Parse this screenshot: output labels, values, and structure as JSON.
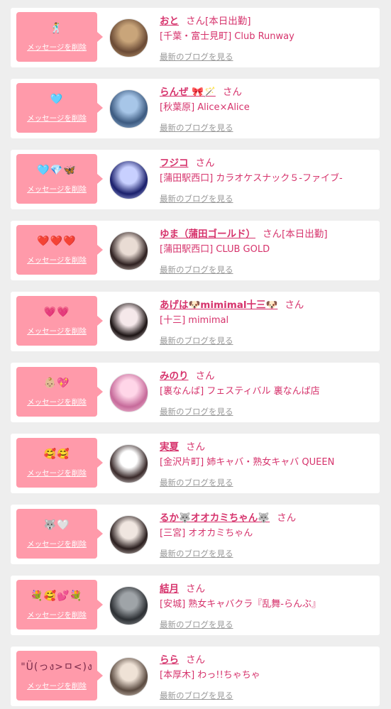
{
  "colors": {
    "accent": "#d6336c",
    "delete_bg": "#ff9aaa",
    "page_bg": "#eeeeee"
  },
  "labels": {
    "delete": "メッセージを削除",
    "blog": "最新のブログを見る",
    "san": "さん"
  },
  "entries": [
    {
      "icons": "🕺",
      "name": "おと",
      "status": "[本日出勤]",
      "shop": "[千葉・富士見町] Club Runway",
      "avatar": [
        "#c9a57a",
        "#6a4a35"
      ]
    },
    {
      "icons": "🩵",
      "name": "らんぜ 🎀🪄",
      "status": "",
      "shop": "[秋葉原] Alice×Alice",
      "avatar": [
        "#a7c6e8",
        "#3c5a80"
      ]
    },
    {
      "icons": "🩵💎🦋",
      "name": "フジコ",
      "status": "",
      "shop": "[蒲田駅西口] カラオケスナック５-ファイブ-",
      "avatar": [
        "#c8d0ff",
        "#1a1f6b"
      ]
    },
    {
      "icons": "❤️❤️❤️",
      "name": "ゆま（蒲田ゴールド）",
      "status": "[本日出勤]",
      "shop": "[蒲田駅西口] CLUB GOLD",
      "avatar": [
        "#e9dcd4",
        "#2e2020"
      ]
    },
    {
      "icons": "💗💗",
      "name": "あげは🐶mimimal十三🐶",
      "status": "",
      "shop": "[十三] mimimal",
      "avatar": [
        "#f5e8ea",
        "#1c1414"
      ]
    },
    {
      "icons": "👶🏼💖",
      "name": "みのり",
      "status": "",
      "shop": "[裏なんば] フェスティバル 裏なんば店",
      "avatar": [
        "#ffd6e8",
        "#c66a9a"
      ]
    },
    {
      "icons": "🥰🥰",
      "name": "実夏",
      "status": "",
      "shop": "[金沢片町] 姉キャバ・熟女キャバ QUEEN",
      "avatar": [
        "#ffffff",
        "#3a2a2a"
      ]
    },
    {
      "icons": "🐺🤍",
      "name": "るか🐺オオカミちゃん🐺",
      "status": "",
      "shop": "[三宮] オオカミちゃん",
      "avatar": [
        "#f0e6e0",
        "#2a1e1e"
      ]
    },
    {
      "icons": "💐🥰💕💐",
      "name": "結月",
      "status": "",
      "shop": "[安城] 熟女キャバクラ『乱舞-らんぶ』",
      "avatar": [
        "#9fa4a8",
        "#2c2f33"
      ]
    },
    {
      "icons": "\"Ü(っง>ㅁ<)ง",
      "name": "らら",
      "status": "",
      "shop": "[本厚木] わっ!!ちゃちゃ",
      "avatar": [
        "#efe2d6",
        "#5a4a40"
      ]
    }
  ]
}
